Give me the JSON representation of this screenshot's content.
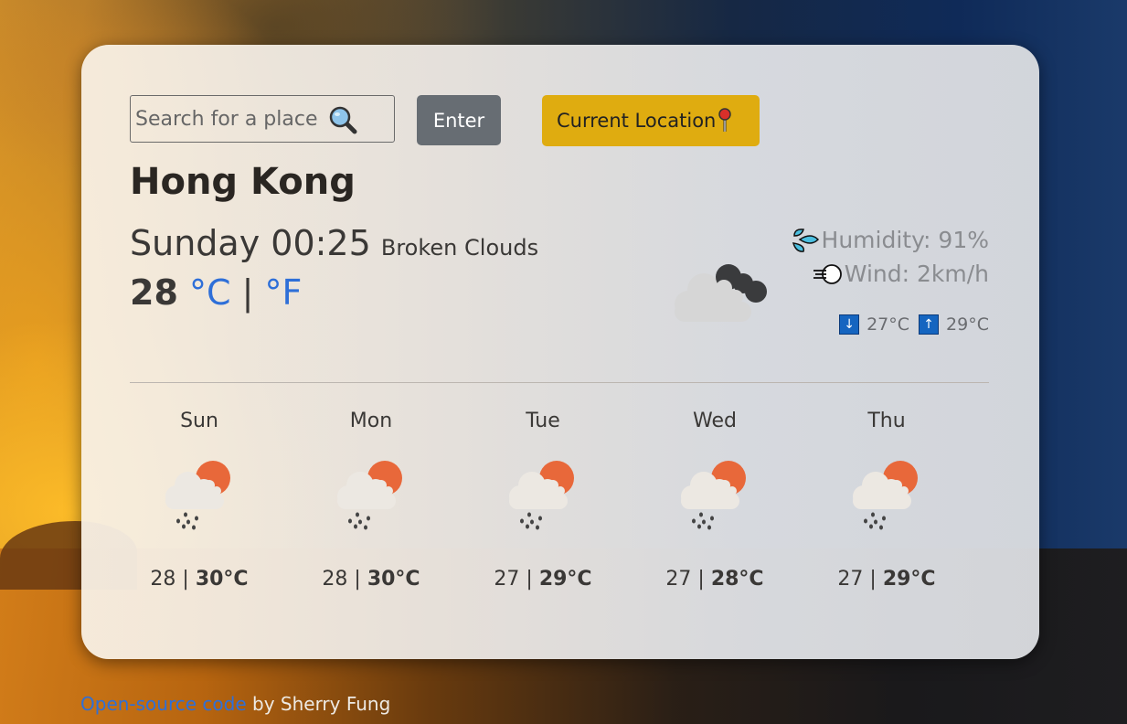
{
  "search": {
    "placeholder": "Search for a place",
    "value": "",
    "icon": "magnifying-glass-icon"
  },
  "buttons": {
    "enter_label": "Enter",
    "current_location_label": "Current Location",
    "current_location_icon": "round-pushpin-icon"
  },
  "current": {
    "city": "Hong Kong",
    "day_time": "Sunday 00:25",
    "description": "Broken Clouds",
    "temperature": "28",
    "unit_celsius": "°C",
    "unit_separator": "|",
    "unit_fahrenheit": "°F",
    "icon": "broken-clouds-icon",
    "humidity_label": "Humidity: 91%",
    "wind_label": "Wind: 2km/h",
    "min_temp": "27°C",
    "max_temp": "29°C",
    "min_arrow": "↓",
    "max_arrow": "↑"
  },
  "forecast": [
    {
      "day": "Sun",
      "low": "28",
      "high": "30°C",
      "icon": "sun-cloud-rain-icon"
    },
    {
      "day": "Mon",
      "low": "28",
      "high": "30°C",
      "icon": "sun-cloud-rain-icon"
    },
    {
      "day": "Tue",
      "low": "27",
      "high": "29°C",
      "icon": "sun-cloud-rain-icon"
    },
    {
      "day": "Wed",
      "low": "27",
      "high": "28°C",
      "icon": "sun-cloud-rain-icon"
    },
    {
      "day": "Thu",
      "low": "27",
      "high": "29°C",
      "icon": "sun-cloud-rain-icon"
    }
  ],
  "footer": {
    "link_text": "Open-source code",
    "suffix": " by Sherry Fung"
  },
  "colors": {
    "accent_link": "#2e6fd8",
    "enter_button": "#676d73",
    "location_button": "#dfac10",
    "arrow_badge": "#1565c0"
  }
}
